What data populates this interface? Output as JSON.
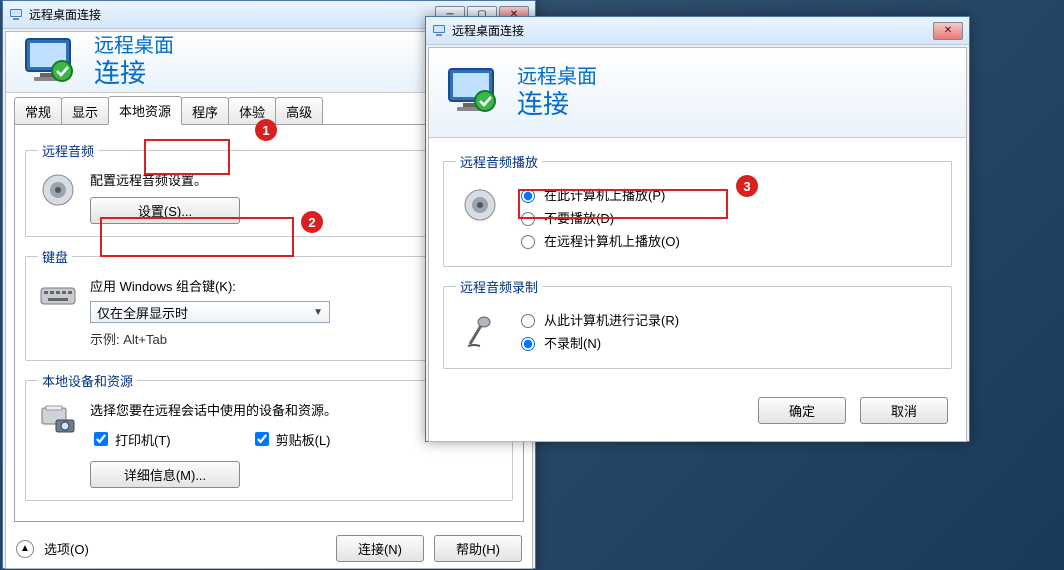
{
  "main": {
    "title": "远程桌面连接",
    "banner": {
      "line1": "远程桌面",
      "line2": "连接"
    },
    "tabs": {
      "general": "常规",
      "display": "显示",
      "localres": "本地资源",
      "programs": "程序",
      "experience": "体验",
      "advanced": "高级"
    },
    "audio": {
      "legend": "远程音频",
      "text": "配置远程音频设置。",
      "settings_btn": "设置(S)..."
    },
    "keyboard": {
      "legend": "键盘",
      "text": "应用 Windows 组合键(K):",
      "combo_value": "仅在全屏显示时",
      "example": "示例: Alt+Tab"
    },
    "devices": {
      "legend": "本地设备和资源",
      "text": "选择您要在远程会话中使用的设备和资源。",
      "printer": "打印机(T)",
      "clipboard": "剪贴板(L)",
      "more_btn": "详细信息(M)..."
    },
    "bottom": {
      "options": "选项(O)",
      "connect": "连接(N)",
      "help": "帮助(H)"
    }
  },
  "dialog": {
    "title": "远程桌面连接",
    "banner": {
      "line1": "远程桌面",
      "line2": "连接"
    },
    "playback": {
      "legend": "远程音频播放",
      "this_computer": "在此计算机上播放(P)",
      "dont_play": "不要播放(D)",
      "remote_computer": "在远程计算机上播放(O)"
    },
    "record": {
      "legend": "远程音频录制",
      "this_computer": "从此计算机进行记录(R)",
      "dont_record": "不录制(N)"
    },
    "ok": "确定",
    "cancel": "取消"
  },
  "annotations": {
    "a1": "1",
    "a2": "2",
    "a3": "3"
  }
}
